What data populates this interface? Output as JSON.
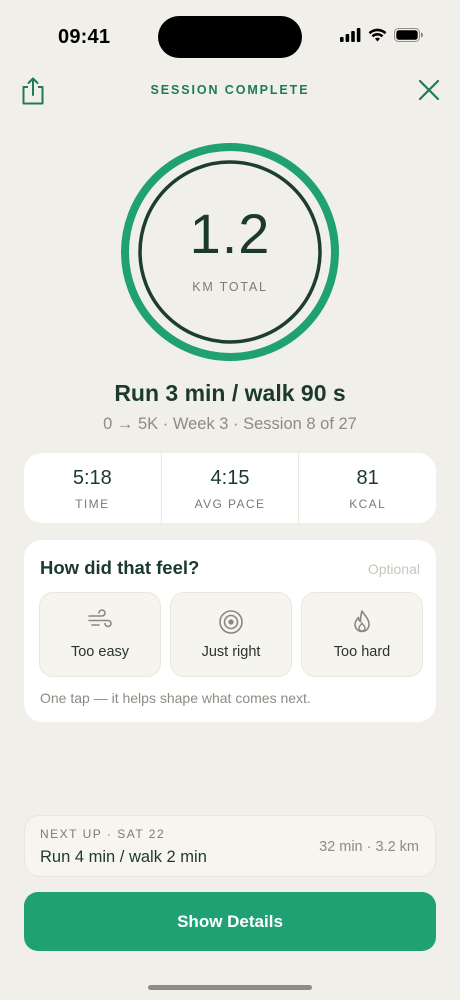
{
  "status_bar": {
    "time": "09:41",
    "icons": [
      "cellular-signal-icon",
      "wifi-icon",
      "battery-icon"
    ]
  },
  "header": {
    "title": "SESSION COMPLETE",
    "share_icon": "share-icon",
    "close_icon": "close-icon"
  },
  "summary": {
    "distance_value": "1.2",
    "distance_unit": "KM TOTAL",
    "session_title": "Run 3 min / walk 90 s",
    "session_subtitle": "0 → 5K · Week 3 · Session 8 of 27"
  },
  "stats": [
    {
      "value": "5:18",
      "label": "TIME"
    },
    {
      "value": "4:15",
      "label": "AVG PACE"
    },
    {
      "value": "81",
      "label": "KCAL"
    }
  ],
  "feedback": {
    "title": "How did that feel?",
    "optional_label": "Optional",
    "options": [
      {
        "label": "Too easy",
        "icon": "wind-icon"
      },
      {
        "label": "Just right",
        "icon": "target-icon"
      },
      {
        "label": "Too hard",
        "icon": "flame-icon"
      }
    ],
    "hint": "One tap — it helps shape what comes next."
  },
  "next_up": {
    "label": "NEXT UP · SAT 22",
    "title": "Run 4 min / walk 2 min",
    "meta": "32 min · 3.2 km"
  },
  "primary_button": {
    "label": "Show Details"
  },
  "colors": {
    "background": "#F1EFE9",
    "accent": "#20A174",
    "accent_dark": "#1F7A58",
    "ring_inner": "#1C3D30",
    "text_primary": "#1C3A2C",
    "text_muted": "#8E8B83"
  }
}
